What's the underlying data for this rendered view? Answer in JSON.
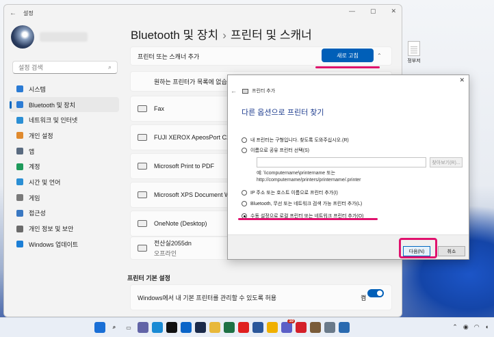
{
  "settings": {
    "window_title": "설정",
    "search_placeholder": "설정 검색",
    "breadcrumb_parent": "Bluetooth 및 장치",
    "breadcrumb_sep": "›",
    "breadcrumb_current": "프린터 및 스캐너",
    "nav": [
      {
        "label": "시스템",
        "icon": "monitor-icon",
        "color": "#2b7bd4"
      },
      {
        "label": "Bluetooth 및 장치",
        "icon": "bluetooth-icon",
        "color": "#2b7bd4"
      },
      {
        "label": "네트워크 및 인터넷",
        "icon": "wifi-icon",
        "color": "#2b8fd4"
      },
      {
        "label": "개인 설정",
        "icon": "brush-icon",
        "color": "#e08a2e"
      },
      {
        "label": "앱",
        "icon": "apps-icon",
        "color": "#5a6b80"
      },
      {
        "label": "계정",
        "icon": "account-icon",
        "color": "#1f9a5b"
      },
      {
        "label": "시간 및 언어",
        "icon": "globe-clock-icon",
        "color": "#2b8fd4"
      },
      {
        "label": "게임",
        "icon": "gamepad-icon",
        "color": "#7a7a7a"
      },
      {
        "label": "접근성",
        "icon": "accessibility-icon",
        "color": "#3a78c2"
      },
      {
        "label": "개인 정보 및 보안",
        "icon": "shield-icon",
        "color": "#6b6b6b"
      },
      {
        "label": "Windows 업데이트",
        "icon": "update-icon",
        "color": "#1c7fd6"
      }
    ],
    "add_printer_label": "프린터 또는 스캐너 추가",
    "refresh_button": "새로 고침",
    "not_listed_text": "원하는 프린터가 목록에 없습니",
    "printers": [
      {
        "name": "Fax",
        "status": ""
      },
      {
        "name": "FUJI XEROX ApeosPort C2060",
        "status": ""
      },
      {
        "name": "Microsoft Print to PDF",
        "status": ""
      },
      {
        "name": "Microsoft XPS Document Wri",
        "status": ""
      },
      {
        "name": "OneNote (Desktop)",
        "status": ""
      },
      {
        "name": "전산실2055dn",
        "status": "오프라인"
      }
    ],
    "printer_prefs_title": "프린터 기본 설정",
    "manage_default_label": "Windows에서 내 기본 프린터를 관리할 수 있도록 허용",
    "toggle_state": "켬"
  },
  "dialog": {
    "title": "프린터 추가",
    "heading": "다른 옵션으로 프린터 찾기",
    "options": [
      {
        "label": "내 프린터는 구형입니다. 찾도록 도와주십시오.(R)",
        "selected": false
      },
      {
        "label": "이름으로 공유 프린터 선택(S)",
        "selected": false
      },
      {
        "label": "IP 주소 또는 호스트 이름으로 프린터 추가(I)",
        "selected": false
      },
      {
        "label": "Bluetooth, 무선 또는 네트워크 검색 가능 프린터 추가(L)",
        "selected": false
      },
      {
        "label": "수동 설정으로 로컬 프린터 또는 네트워크 프린터 추가(O)",
        "selected": true
      }
    ],
    "browse_button": "찾아보기(R)...",
    "example_line1": "예: \\\\computername\\printername 또는",
    "example_line2": "http://computername/printers/printername/.printer",
    "next_button": "다음(N)",
    "cancel_button": "취소"
  },
  "desktop": {
    "file_label": "정부저"
  },
  "taskbar": {
    "apps": [
      {
        "icon": "windows-start-icon",
        "color": "#1a6fd6"
      },
      {
        "icon": "search-icon",
        "color": "#333333"
      },
      {
        "icon": "task-view-icon",
        "color": "#444444"
      },
      {
        "icon": "chat-icon",
        "color": "#6264a7"
      },
      {
        "icon": "edge-icon",
        "color": "#1a8ad4"
      },
      {
        "icon": "notion-icon",
        "color": "#111111"
      },
      {
        "icon": "outlook-icon",
        "color": "#0a64c8"
      },
      {
        "icon": "photoshop-icon",
        "color": "#1b2a4a"
      },
      {
        "icon": "folder-icon",
        "color": "#e8b83a"
      },
      {
        "icon": "excel-icon",
        "color": "#1e7145"
      },
      {
        "icon": "youtube-icon",
        "color": "#e02020"
      },
      {
        "icon": "word-icon",
        "color": "#2b579a"
      },
      {
        "icon": "notes-icon",
        "color": "#f0b000"
      },
      {
        "icon": "teams-icon",
        "color": "#5b5fc7"
      },
      {
        "icon": "acrobat-icon",
        "color": "#d4202a"
      },
      {
        "icon": "app-icon",
        "color": "#7a5c3a"
      },
      {
        "icon": "settings-icon",
        "color": "#6a7a8a"
      },
      {
        "icon": "monitor-app-icon",
        "color": "#2a6ab0"
      }
    ],
    "teams_badge": "10"
  },
  "annotation_color": "#e0116d"
}
